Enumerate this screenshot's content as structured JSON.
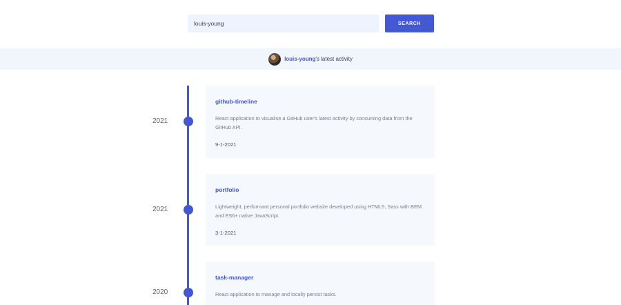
{
  "search": {
    "value": "louis-young",
    "button_label": "SEARCH"
  },
  "banner": {
    "username": "louis-young",
    "suffix": "'s latest activity"
  },
  "timeline": [
    {
      "year": "2021",
      "title": "github-timeline",
      "description": "React application to visualise a GitHub user's latest activity by consuming data from the GitHub API.",
      "date": "9-1-2021"
    },
    {
      "year": "2021",
      "title": "portfolio",
      "description": "Lightweight, performant personal portfolio website developed using HTML5, Sass with BEM and ES6+ native JavaScript.",
      "date": "3-1-2021"
    },
    {
      "year": "2020",
      "title": "task-manager",
      "description": "React application to manage and locally persist tasks.",
      "date": ""
    }
  ],
  "colors": {
    "accent": "#4458d4",
    "banner_bg": "#f1f6fd",
    "card_bg": "#f5f8fd"
  }
}
